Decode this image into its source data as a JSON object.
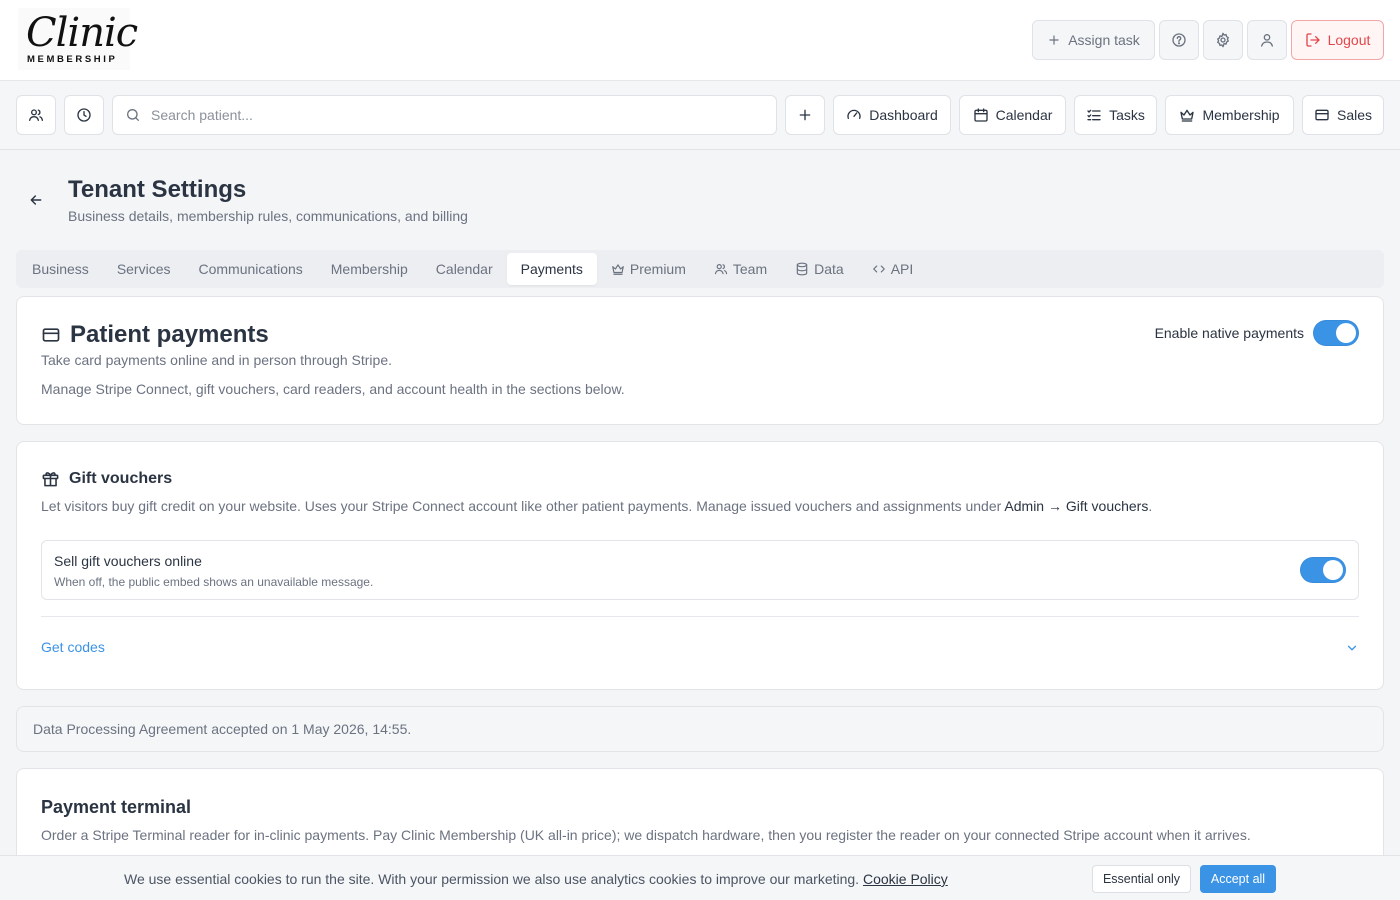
{
  "logo": {
    "script": "Clinic",
    "sub": "MEMBERSHIP"
  },
  "topbar": {
    "assign_task_label": "Assign task",
    "logout_label": "Logout"
  },
  "nav": {
    "search_placeholder": "Search patient...",
    "dashboard": "Dashboard",
    "calendar": "Calendar",
    "tasks": "Tasks",
    "membership": "Membership",
    "sales": "Sales"
  },
  "page": {
    "title": "Tenant Settings",
    "subtitle": "Business details, membership rules, communications, and billing"
  },
  "tabs": [
    {
      "label": "Business"
    },
    {
      "label": "Services"
    },
    {
      "label": "Communications"
    },
    {
      "label": "Membership"
    },
    {
      "label": "Calendar"
    },
    {
      "label": "Payments",
      "active": true
    },
    {
      "label": "Premium",
      "icon": "crown-icon"
    },
    {
      "label": "Team",
      "icon": "users-icon"
    },
    {
      "label": "Data",
      "icon": "database-icon"
    },
    {
      "label": "API",
      "icon": "code-icon"
    }
  ],
  "payments_card": {
    "title": "Patient payments",
    "desc1": "Take card payments online and in person through Stripe.",
    "desc2": "Manage Stripe Connect, gift vouchers, card readers, and account health in the sections below.",
    "toggle_label": "Enable native payments",
    "toggle_on": true
  },
  "gift_card": {
    "title": "Gift vouchers",
    "desc_prefix": "Let visitors buy gift credit on your website. Uses your Stripe Connect account like other patient payments. Manage issued vouchers and assignments under ",
    "desc_link": "Admin → Gift vouchers",
    "desc_suffix": ".",
    "sell_title": "Sell gift vouchers online",
    "sell_desc": "When off, the public embed shows an unavailable message.",
    "sell_on": true,
    "get_codes": "Get codes"
  },
  "dpa": {
    "text": "Data Processing Agreement accepted on 1 May 2026, 14:55."
  },
  "terminal": {
    "title": "Payment terminal",
    "desc": "Order a Stripe Terminal reader for in-clinic payments. Pay Clinic Membership (UK all-in price); we dispatch hardware, then you register the reader on your connected Stripe account when it arrives."
  },
  "cookie": {
    "text": "We use essential cookies to run the site. With your permission we also use analytics cookies to improve our marketing.",
    "link": "Cookie Policy",
    "essential": "Essential only",
    "accept": "Accept all"
  },
  "colors": {
    "accent": "#3b93e6",
    "logout": "#e0474c",
    "link": "#3b93e6"
  }
}
